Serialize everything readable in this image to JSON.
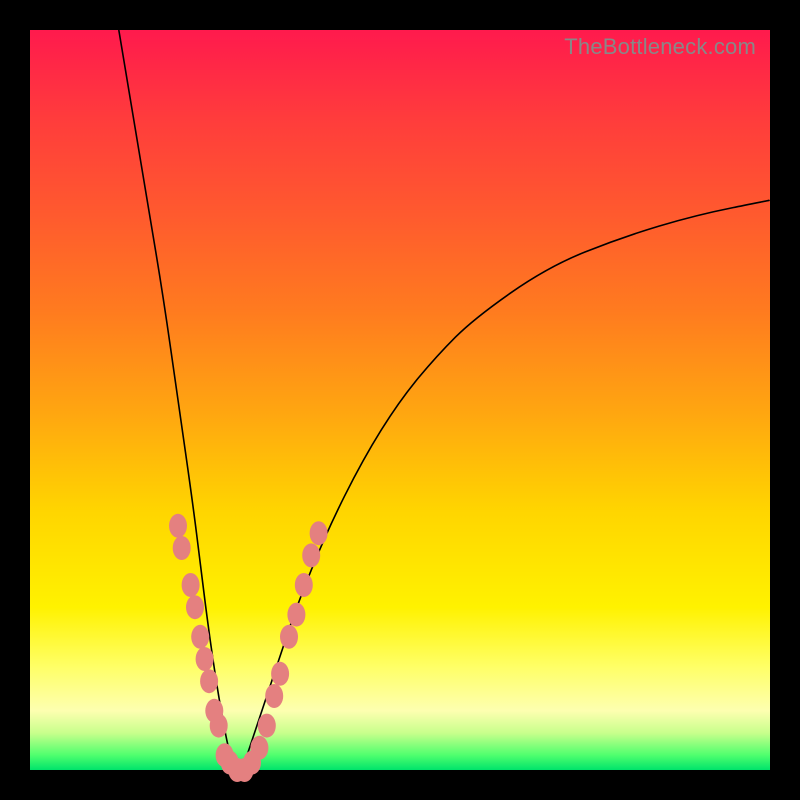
{
  "watermark": "TheBottleneck.com",
  "chart_data": {
    "type": "line",
    "title": "",
    "xlabel": "",
    "ylabel": "",
    "xlim": [
      0,
      100
    ],
    "ylim": [
      0,
      100
    ],
    "legend": false,
    "grid": false,
    "background": "rainbow-vertical-gradient",
    "curve_description": "V-shaped bottleneck curve touching y=0 near x≈28",
    "series": [
      {
        "name": "bottleneck-curve",
        "x": [
          12,
          14,
          16,
          18,
          20,
          22,
          23,
          24,
          25,
          26,
          27,
          28,
          29,
          30,
          32,
          34,
          36,
          40,
          45,
          50,
          55,
          60,
          70,
          80,
          90,
          100
        ],
        "y": [
          100,
          88,
          76,
          64,
          50,
          36,
          28,
          20,
          13,
          7,
          2,
          0,
          1,
          4,
          10,
          16,
          22,
          32,
          42,
          50,
          56,
          61,
          68,
          72,
          75,
          77
        ]
      }
    ],
    "highlighted_points": {
      "name": "pink-dots",
      "description": "highlighted samples along both arms of the V near the minimum",
      "points": [
        {
          "x": 20.0,
          "y": 33
        },
        {
          "x": 20.5,
          "y": 30
        },
        {
          "x": 21.7,
          "y": 25
        },
        {
          "x": 22.3,
          "y": 22
        },
        {
          "x": 23.0,
          "y": 18
        },
        {
          "x": 23.6,
          "y": 15
        },
        {
          "x": 24.2,
          "y": 12
        },
        {
          "x": 24.9,
          "y": 8
        },
        {
          "x": 25.5,
          "y": 6
        },
        {
          "x": 26.3,
          "y": 2
        },
        {
          "x": 27.0,
          "y": 1
        },
        {
          "x": 28.0,
          "y": 0
        },
        {
          "x": 29.0,
          "y": 0
        },
        {
          "x": 30.0,
          "y": 1
        },
        {
          "x": 31.0,
          "y": 3
        },
        {
          "x": 32.0,
          "y": 6
        },
        {
          "x": 33.0,
          "y": 10
        },
        {
          "x": 33.8,
          "y": 13
        },
        {
          "x": 35.0,
          "y": 18
        },
        {
          "x": 36.0,
          "y": 21
        },
        {
          "x": 37.0,
          "y": 25
        },
        {
          "x": 38.0,
          "y": 29
        },
        {
          "x": 39.0,
          "y": 32
        }
      ]
    }
  }
}
